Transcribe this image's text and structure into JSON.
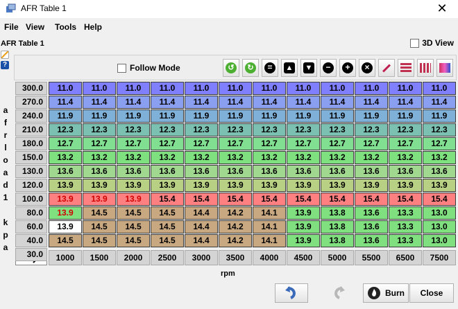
{
  "window": {
    "title": "AFR Table 1",
    "icon": "app-icon",
    "close_label": "✕"
  },
  "menu": [
    "File",
    "View",
    "Tools",
    "Help"
  ],
  "table_label": "AFR Table 1",
  "view3d_label": "3D View",
  "view3d_checked": false,
  "follow_mode_label": "Follow Mode",
  "follow_mode_checked": false,
  "toolbar_icons": [
    "rotate-left-icon",
    "rotate-right-icon",
    "minus-square-icon",
    "arrow-up-icon",
    "arrow-down-icon",
    "minus-circle-icon",
    "plus-circle-icon",
    "cancel-circle-icon",
    "pen-icon",
    "horizontal-bars-icon",
    "vertical-bars-icon",
    "gradient-icon"
  ],
  "y_axis": {
    "label_lines": [
      "a",
      "f",
      "r",
      "l",
      "o",
      "a",
      "d",
      "1",
      "",
      "k",
      "p",
      "a"
    ],
    "values": [
      "300.0",
      "270.0",
      "240.0",
      "210.0",
      "180.0",
      "150.0",
      "130.0",
      "120.0",
      "100.0",
      "80.0",
      "60.0",
      "40.0",
      "30.0"
    ]
  },
  "x_axis": {
    "label": "rpm",
    "values": [
      "1000",
      "1500",
      "2000",
      "2500",
      "3000",
      "3500",
      "4000",
      "4500",
      "5000",
      "5500",
      "6500",
      "7500"
    ]
  },
  "table": [
    [
      "11.0",
      "11.0",
      "11.0",
      "11.0",
      "11.0",
      "11.0",
      "11.0",
      "11.0",
      "11.0",
      "11.0",
      "11.0",
      "11.0"
    ],
    [
      "11.4",
      "11.4",
      "11.4",
      "11.4",
      "11.4",
      "11.4",
      "11.4",
      "11.4",
      "11.4",
      "11.4",
      "11.4",
      "11.4"
    ],
    [
      "11.9",
      "11.9",
      "11.9",
      "11.9",
      "11.9",
      "11.9",
      "11.9",
      "11.9",
      "11.9",
      "11.9",
      "11.9",
      "11.9"
    ],
    [
      "12.3",
      "12.3",
      "12.3",
      "12.3",
      "12.3",
      "12.3",
      "12.3",
      "12.3",
      "12.3",
      "12.3",
      "12.3",
      "12.3"
    ],
    [
      "12.7",
      "12.7",
      "12.7",
      "12.7",
      "12.7",
      "12.7",
      "12.7",
      "12.7",
      "12.7",
      "12.7",
      "12.7",
      "12.7"
    ],
    [
      "13.2",
      "13.2",
      "13.2",
      "13.2",
      "13.2",
      "13.2",
      "13.2",
      "13.2",
      "13.2",
      "13.2",
      "13.2",
      "13.2"
    ],
    [
      "13.6",
      "13.6",
      "13.6",
      "13.6",
      "13.6",
      "13.6",
      "13.6",
      "13.6",
      "13.6",
      "13.6",
      "13.6",
      "13.6"
    ],
    [
      "13.9",
      "13.9",
      "13.9",
      "13.9",
      "13.9",
      "13.9",
      "13.9",
      "13.9",
      "13.9",
      "13.9",
      "13.9",
      "13.9"
    ],
    [
      "13.9",
      "13.9",
      "13.9",
      "15.4",
      "15.4",
      "15.4",
      "15.4",
      "15.4",
      "15.4",
      "15.4",
      "15.4",
      "15.4"
    ],
    [
      "13.9",
      "14.5",
      "14.5",
      "14.5",
      "14.4",
      "14.2",
      "14.1",
      "13.9",
      "13.8",
      "13.6",
      "13.3",
      "13.0"
    ],
    [
      "13.9",
      "14.5",
      "14.5",
      "14.5",
      "14.4",
      "14.2",
      "14.1",
      "13.9",
      "13.8",
      "13.6",
      "13.3",
      "13.0"
    ],
    [
      "14.5",
      "14.5",
      "14.5",
      "14.5",
      "14.4",
      "14.2",
      "14.1",
      "13.9",
      "13.8",
      "13.6",
      "13.3",
      "13.0"
    ]
  ],
  "row_colors": [
    "#8080ff",
    "#8b9ff0",
    "#7fb0d8",
    "#7bc0b0",
    "#80df90",
    "#7ee07e",
    "#a0d890",
    "#b8d084",
    "#ff8080",
    null,
    null,
    null
  ],
  "warm_color": "#c8a880",
  "green_cell_color": "#80e080",
  "selected_cell_bg": "#ffffff",
  "red_text_color": "#d00000",
  "red_text_cells": [
    [
      8,
      0
    ],
    [
      8,
      1
    ],
    [
      8,
      2
    ],
    [
      9,
      0
    ]
  ],
  "selected_cell": [
    10,
    0
  ],
  "buttons": {
    "undo": "undo-icon",
    "redo": "redo-icon",
    "burn": "Burn",
    "close": "Close"
  }
}
